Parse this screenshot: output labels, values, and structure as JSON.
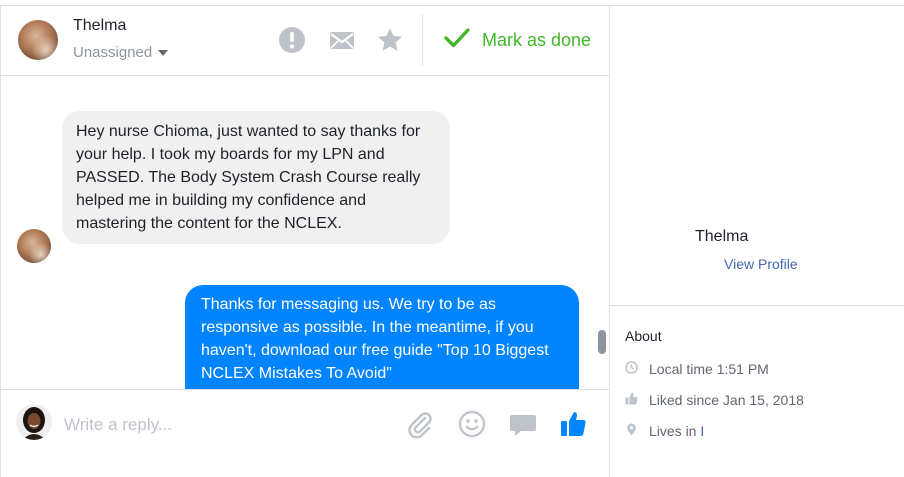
{
  "conversation": {
    "contact_name": "Thelma",
    "assignment": "Unassigned",
    "mark_done_label": "Mark as done"
  },
  "messages": [
    {
      "direction": "incoming",
      "text": "Hey nurse Chioma, just wanted to say thanks for your help. I took my boards for my LPN and PASSED. The Body System Crash Course really helped me in building my confidence and mastering the content for the NCLEX."
    },
    {
      "direction": "outgoing",
      "text": "Thanks for messaging us. We try to be as responsive as possible. In the meantime, if you haven't, download our free guide \"Top 10 Biggest NCLEX Mistakes To Avoid\""
    }
  ],
  "composer": {
    "placeholder": "Write a reply..."
  },
  "profile": {
    "name": "Thelma",
    "view_profile_label": "View Profile",
    "about_title": "About",
    "local_time": "Local time 1:51 PM",
    "liked_since": "Liked since Jan 15, 2018",
    "lives_in_prefix": "Lives in ",
    "lives_in_fragment": "I"
  },
  "colors": {
    "accent_blue": "#0084ff",
    "done_green": "#42b72a",
    "link_blue": "#4267b2",
    "icon_gray": "#bec3c9",
    "incoming_bubble": "#f1f0f0"
  },
  "icons": {
    "header": [
      "exclamation-icon",
      "envelope-icon",
      "star-icon",
      "checkmark-icon"
    ],
    "composer": [
      "paperclip-icon",
      "smiley-icon",
      "speech-bubble-icon",
      "thumbs-up-icon"
    ],
    "about": [
      "clock-icon",
      "thumbs-up-icon",
      "location-pin-icon"
    ]
  }
}
